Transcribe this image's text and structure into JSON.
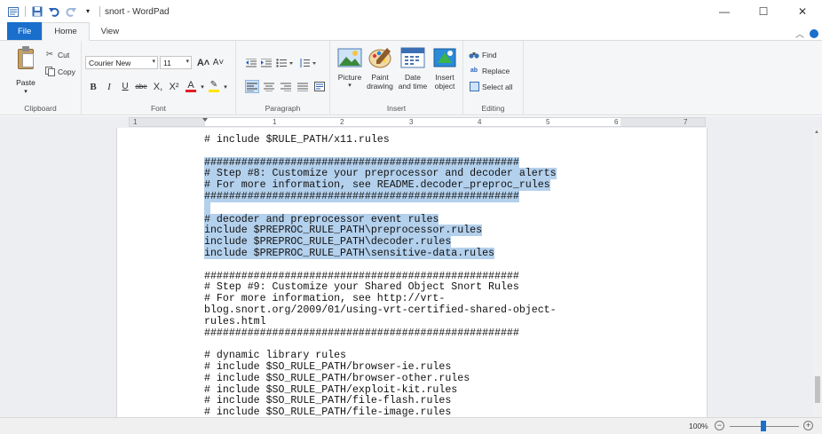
{
  "window": {
    "title": "snort - WordPad",
    "controls": {
      "minimize": "—",
      "maximize": "☐",
      "close": "✕"
    }
  },
  "quick_access": {
    "icons": [
      "app-menu-icon",
      "save-icon",
      "undo-icon",
      "redo-icon",
      "customize-icon"
    ]
  },
  "tabs": [
    {
      "label": "File"
    },
    {
      "label": "Home"
    },
    {
      "label": "View"
    }
  ],
  "ribbon": {
    "clipboard": {
      "label": "Clipboard",
      "paste": "Paste",
      "cut": "Cut",
      "copy": "Copy"
    },
    "font": {
      "label": "Font",
      "family": "Courier New",
      "size": "11",
      "bold": "B",
      "italic": "I",
      "underline": "U",
      "strike": "abe",
      "subscript": "X,",
      "superscript": "X²",
      "font_color": "A",
      "highlight": "✎",
      "grow": "A˄",
      "shrink": "A˅"
    },
    "paragraph": {
      "label": "Paragraph"
    },
    "insert": {
      "label": "Insert",
      "picture": "Picture",
      "paint": "Paint drawing",
      "datetime": "Date and time",
      "object": "Insert object"
    },
    "editing": {
      "label": "Editing",
      "find": "Find",
      "replace": "Replace",
      "select_all": "Select all"
    }
  },
  "ruler": {
    "marks": [
      "1",
      "1",
      "2",
      "3",
      "4",
      "5",
      "6",
      "7"
    ]
  },
  "document": {
    "lines": [
      {
        "text": "# include $RULE_PATH/x11.rules",
        "selected": false
      },
      {
        "text": "",
        "selected": false
      },
      {
        "text": "###################################################",
        "selected": true
      },
      {
        "text": "# Step #8: Customize your preprocessor and decoder alerts",
        "selected": true
      },
      {
        "text": "# For more information, see README.decoder_preproc_rules",
        "selected": true
      },
      {
        "text": "###################################################",
        "selected": true
      },
      {
        "text": " ",
        "selected": true
      },
      {
        "text": "# decoder and preprocessor event rules",
        "selected": true
      },
      {
        "text": "include $PREPROC_RULE_PATH\\preprocessor.rules",
        "selected": true
      },
      {
        "text": "include $PREPROC_RULE_PATH\\decoder.rules",
        "selected": true
      },
      {
        "text": "include $PREPROC_RULE_PATH\\sensitive-data.rules",
        "selected": true
      },
      {
        "text": "",
        "selected": false
      },
      {
        "text": "###################################################",
        "selected": false
      },
      {
        "text": "# Step #9: Customize your Shared Object Snort Rules",
        "selected": false
      },
      {
        "text": "# For more information, see http://vrt-",
        "selected": false
      },
      {
        "text": "blog.snort.org/2009/01/using-vrt-certified-shared-object-",
        "selected": false
      },
      {
        "text": "rules.html",
        "selected": false
      },
      {
        "text": "###################################################",
        "selected": false
      },
      {
        "text": "",
        "selected": false
      },
      {
        "text": "# dynamic library rules",
        "selected": false
      },
      {
        "text": "# include $SO_RULE_PATH/browser-ie.rules",
        "selected": false
      },
      {
        "text": "# include $SO_RULE_PATH/browser-other.rules",
        "selected": false
      },
      {
        "text": "# include $SO_RULE_PATH/exploit-kit.rules",
        "selected": false
      },
      {
        "text": "# include $SO_RULE_PATH/file-flash.rules",
        "selected": false
      },
      {
        "text": "# include $SO_RULE_PATH/file-image.rules",
        "selected": false
      }
    ]
  },
  "statusbar": {
    "zoom": "100%",
    "zoom_level": 1.0
  },
  "colors": {
    "accent": "#1a6ecc",
    "selection": "#b3d0ec",
    "ribbon_bg": "#f5f6f7"
  }
}
